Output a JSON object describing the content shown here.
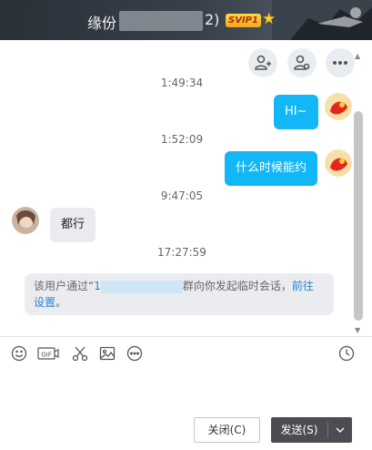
{
  "title": {
    "name_prefix": "缘份",
    "name_suffix": "2)",
    "vip_badge": "SVIP1",
    "star": "★"
  },
  "toolbar": {
    "icons": [
      "add-person-icon",
      "person-settings-icon",
      "more-icon"
    ]
  },
  "messages": [
    {
      "type": "timestamp",
      "text": "1:49:34"
    },
    {
      "type": "bubble",
      "side": "me",
      "text": "HI~"
    },
    {
      "type": "timestamp",
      "text": "1:52:09"
    },
    {
      "type": "bubble",
      "side": "me",
      "text": "什么时候能约"
    },
    {
      "type": "timestamp",
      "text": "9:47:05"
    },
    {
      "type": "bubble",
      "side": "other",
      "text": "都行"
    },
    {
      "type": "timestamp",
      "text": "17:27:59"
    }
  ],
  "system_message": {
    "prefix": "该用户通过“",
    "blurred_start": "1",
    "middle": "群向你发起临时会话，",
    "link_1": "前往",
    "link_2": "设置",
    "suffix": "。"
  },
  "input_toolbar": {
    "icons": [
      "emoji-icon",
      "gif-icon",
      "scissors-icon",
      "image-icon",
      "more-options-icon",
      "history-clock-icon"
    ],
    "gif_label": "GIF"
  },
  "buttons": {
    "close": "关闭(C)",
    "send": "发送(S)"
  },
  "colors": {
    "bubble_me": "#12b7f5",
    "bubble_other": "#e9ebee",
    "send_button": "#4c4c52"
  }
}
